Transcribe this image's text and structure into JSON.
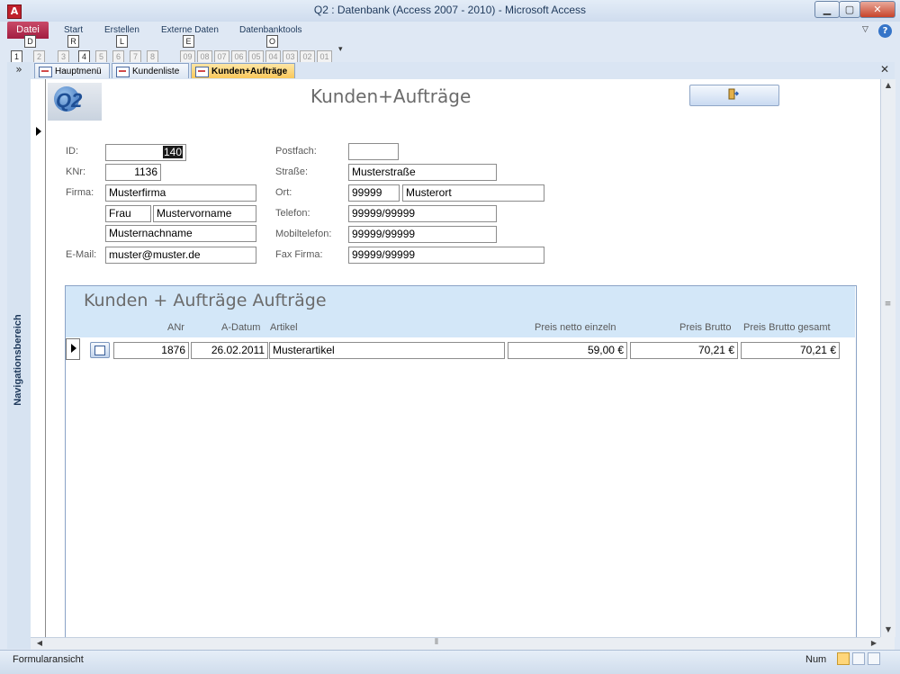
{
  "window": {
    "title": "Q2 : Datenbank (Access 2007 - 2010)  -  Microsoft Access",
    "app_icon_letter": "A",
    "controls": {
      "minimize": "▁",
      "maximize": "▢",
      "close": "✕"
    }
  },
  "ribbon": {
    "file_tab": "Datei",
    "tabs": [
      "Start",
      "Erstellen",
      "Externe Daten",
      "Datenbanktools"
    ],
    "keytips": {
      "datei": "D",
      "start": "R",
      "erstellen": "L",
      "externe": "E",
      "datenbanktools": "O",
      "qat": [
        "1",
        "2",
        "3",
        "4",
        "5",
        "6",
        "7",
        "8",
        "09",
        "08",
        "07",
        "06",
        "05",
        "04",
        "03",
        "02",
        "01"
      ]
    },
    "help": "?",
    "collapse": "▽",
    "qat_more": "▾"
  },
  "document_tabs": [
    {
      "label": "Hauptmenü",
      "active": false
    },
    {
      "label": "Kundenliste",
      "active": false
    },
    {
      "label": "Kunden+Aufträge",
      "active": true
    }
  ],
  "doc_close": "✕",
  "nav_pane": {
    "label": "Navigationsbereich",
    "toggle": "»"
  },
  "form": {
    "title": "Kunden+Aufträge",
    "logo_text": "Q2",
    "fields": {
      "id": {
        "label": "ID:",
        "value": "140"
      },
      "knr": {
        "label": "KNr:",
        "value": "1136"
      },
      "firma": {
        "label": "Firma:",
        "value": "Musterfirma"
      },
      "anrede": {
        "value": "Frau"
      },
      "vorname": {
        "value": "Mustervorname"
      },
      "nachname": {
        "value": "Musternachname"
      },
      "email": {
        "label": "E-Mail:",
        "value": "muster@muster.de"
      },
      "postfach": {
        "label": "Postfach:",
        "value": ""
      },
      "strasse": {
        "label": "Straße:",
        "value": "Musterstraße"
      },
      "plz": {
        "label": "Ort:",
        "value": "99999"
      },
      "ort": {
        "value": "Musterort"
      },
      "telefon": {
        "label": "Telefon:",
        "value": "99999/99999"
      },
      "mobil": {
        "label": "Mobiltelefon:",
        "value": "99999/99999"
      },
      "fax": {
        "label": "Fax Firma:",
        "value": "99999/99999"
      }
    }
  },
  "subform": {
    "title": "Kunden + Aufträge Aufträge",
    "columns": [
      "ANr",
      "A-Datum",
      "Artikel",
      "Preis netto einzeln",
      "Preis Brutto",
      "Preis Brutto gesamt"
    ],
    "rows": [
      {
        "anr": "1876",
        "datum": "26.02.2011",
        "artikel": "Musterartikel",
        "netto": "59,00 €",
        "brutto": "70,21 €",
        "gesamt": "70,21 €"
      }
    ]
  },
  "scrollbars": {
    "up": "▲",
    "down": "▼",
    "left": "◀",
    "right": "▶",
    "grip": "≡",
    "hgrip": "⦀"
  },
  "status": {
    "view": "Formularansicht",
    "num": "Num"
  },
  "colors": {
    "accent": "#a21d41",
    "active_tab": "#f9c85b",
    "subform_header": "#d3e7f8"
  }
}
